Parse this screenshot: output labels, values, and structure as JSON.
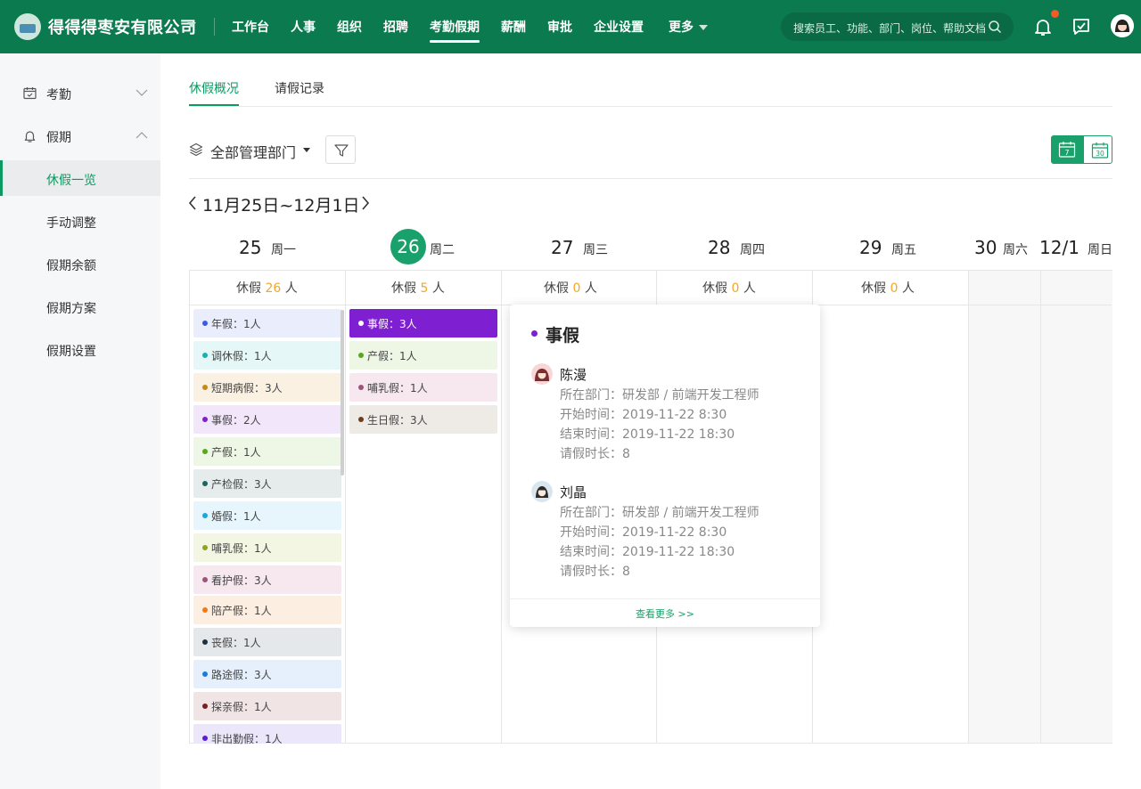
{
  "topbar": {
    "company": "得得得枣安有限公司",
    "nav": [
      "工作台",
      "人事",
      "组织",
      "招聘",
      "考勤假期",
      "薪酬",
      "审批",
      "企业设置",
      "更多"
    ],
    "active_nav": "考勤假期",
    "search_placeholder": "搜索员工、功能、部门、岗位、帮助文档"
  },
  "sidebar": {
    "groups": [
      {
        "label": "考勤"
      },
      {
        "label": "假期"
      }
    ],
    "items": [
      "休假一览",
      "手动调整",
      "假期余额",
      "假期方案",
      "假期设置"
    ],
    "active_item": "休假一览"
  },
  "tabs": [
    "休假概况",
    "请假记录"
  ],
  "toolbar": {
    "dept_label": "全部管理部门",
    "view_week": "7",
    "view_month": "30"
  },
  "week": {
    "range": "11月25日~12月1日",
    "days": [
      {
        "num": "25",
        "wk": "周一"
      },
      {
        "num": "26",
        "wk": "周二"
      },
      {
        "num": "27",
        "wk": "周三"
      },
      {
        "num": "28",
        "wk": "周四"
      },
      {
        "num": "29",
        "wk": "周五"
      },
      {
        "num": "30",
        "wk": "周六"
      },
      {
        "num": "12/1",
        "wk": "周日"
      }
    ],
    "counts": [
      {
        "pre": "休假",
        "num": "26",
        "post": "人"
      },
      {
        "pre": "休假",
        "num": "5",
        "post": "人"
      },
      {
        "pre": "休假",
        "num": "0",
        "post": "人"
      },
      {
        "pre": "休假",
        "num": "0",
        "post": "人"
      },
      {
        "pre": "休假",
        "num": "0",
        "post": "人"
      }
    ]
  },
  "monday_leaves": [
    {
      "text": "年假：1人",
      "bg": "#eaeefc",
      "dot": "#3d5ae6"
    },
    {
      "text": "调休假：1人",
      "bg": "#e6f7f7",
      "dot": "#16b2b2"
    },
    {
      "text": "短期病假：3人",
      "bg": "#faf1e3",
      "dot": "#c48a15"
    },
    {
      "text": "事假：2人",
      "bg": "#f1e6fa",
      "dot": "#7e1fd1"
    },
    {
      "text": "产假：1人",
      "bg": "#eef6e6",
      "dot": "#58a81e"
    },
    {
      "text": "产检假：3人",
      "bg": "#e6ecec",
      "dot": "#1a6660"
    },
    {
      "text": "婚假：1人",
      "bg": "#e6f6fc",
      "dot": "#1aa8df"
    },
    {
      "text": "哺乳假：1人",
      "bg": "#f2f6e3",
      "dot": "#8ca51e"
    },
    {
      "text": "看护假：3人",
      "bg": "#f6e8ee",
      "dot": "#a0527a"
    },
    {
      "text": "陪产假：1人",
      "bg": "#fdeee2",
      "dot": "#f07a18"
    },
    {
      "text": "丧假：1人",
      "bg": "#e5e8ea",
      "dot": "#1f3140"
    },
    {
      "text": "路途假：3人",
      "bg": "#e5f0fc",
      "dot": "#1a7ae0"
    },
    {
      "text": "探亲假：1人",
      "bg": "#f1e4e4",
      "dot": "#7a1f1f"
    },
    {
      "text": "非出勤假：1人",
      "bg": "#ece6fa",
      "dot": "#5a1fd1"
    }
  ],
  "tuesday_leaves": [
    {
      "text": "事假：3人",
      "bg": "#7e1fd1",
      "dot": "#ffffff",
      "color": "#ffffff"
    },
    {
      "text": "产假：1人",
      "bg": "#eef6e6",
      "dot": "#58a81e",
      "color": "#444444"
    },
    {
      "text": "哺乳假：1人",
      "bg": "#f6e8ee",
      "dot": "#a0527a",
      "color": "#444444"
    },
    {
      "text": "生日假：3人",
      "bg": "#eeeae6",
      "dot": "#6a3f1f",
      "color": "#444444"
    }
  ],
  "popover": {
    "title": "事假",
    "people": [
      {
        "name": "陈漫",
        "dept": "所在部门：研发部 / 前端开发工程师",
        "start": "开始时间：2019-11-22 8:30",
        "end": "结束时间：2019-11-22 18:30",
        "duration": "请假时长：8"
      },
      {
        "name": "刘晶",
        "dept": "所在部门：研发部 / 前端开发工程师",
        "start": "开始时间：2019-11-22 8:30",
        "end": "结束时间：2019-11-22 18:30",
        "duration": "请假时长：8"
      }
    ],
    "more": "查看更多 >>"
  },
  "colors": {
    "brand": "#0b7a4f",
    "accent": "#1aa06a",
    "count_highlight": "#f5a623"
  }
}
